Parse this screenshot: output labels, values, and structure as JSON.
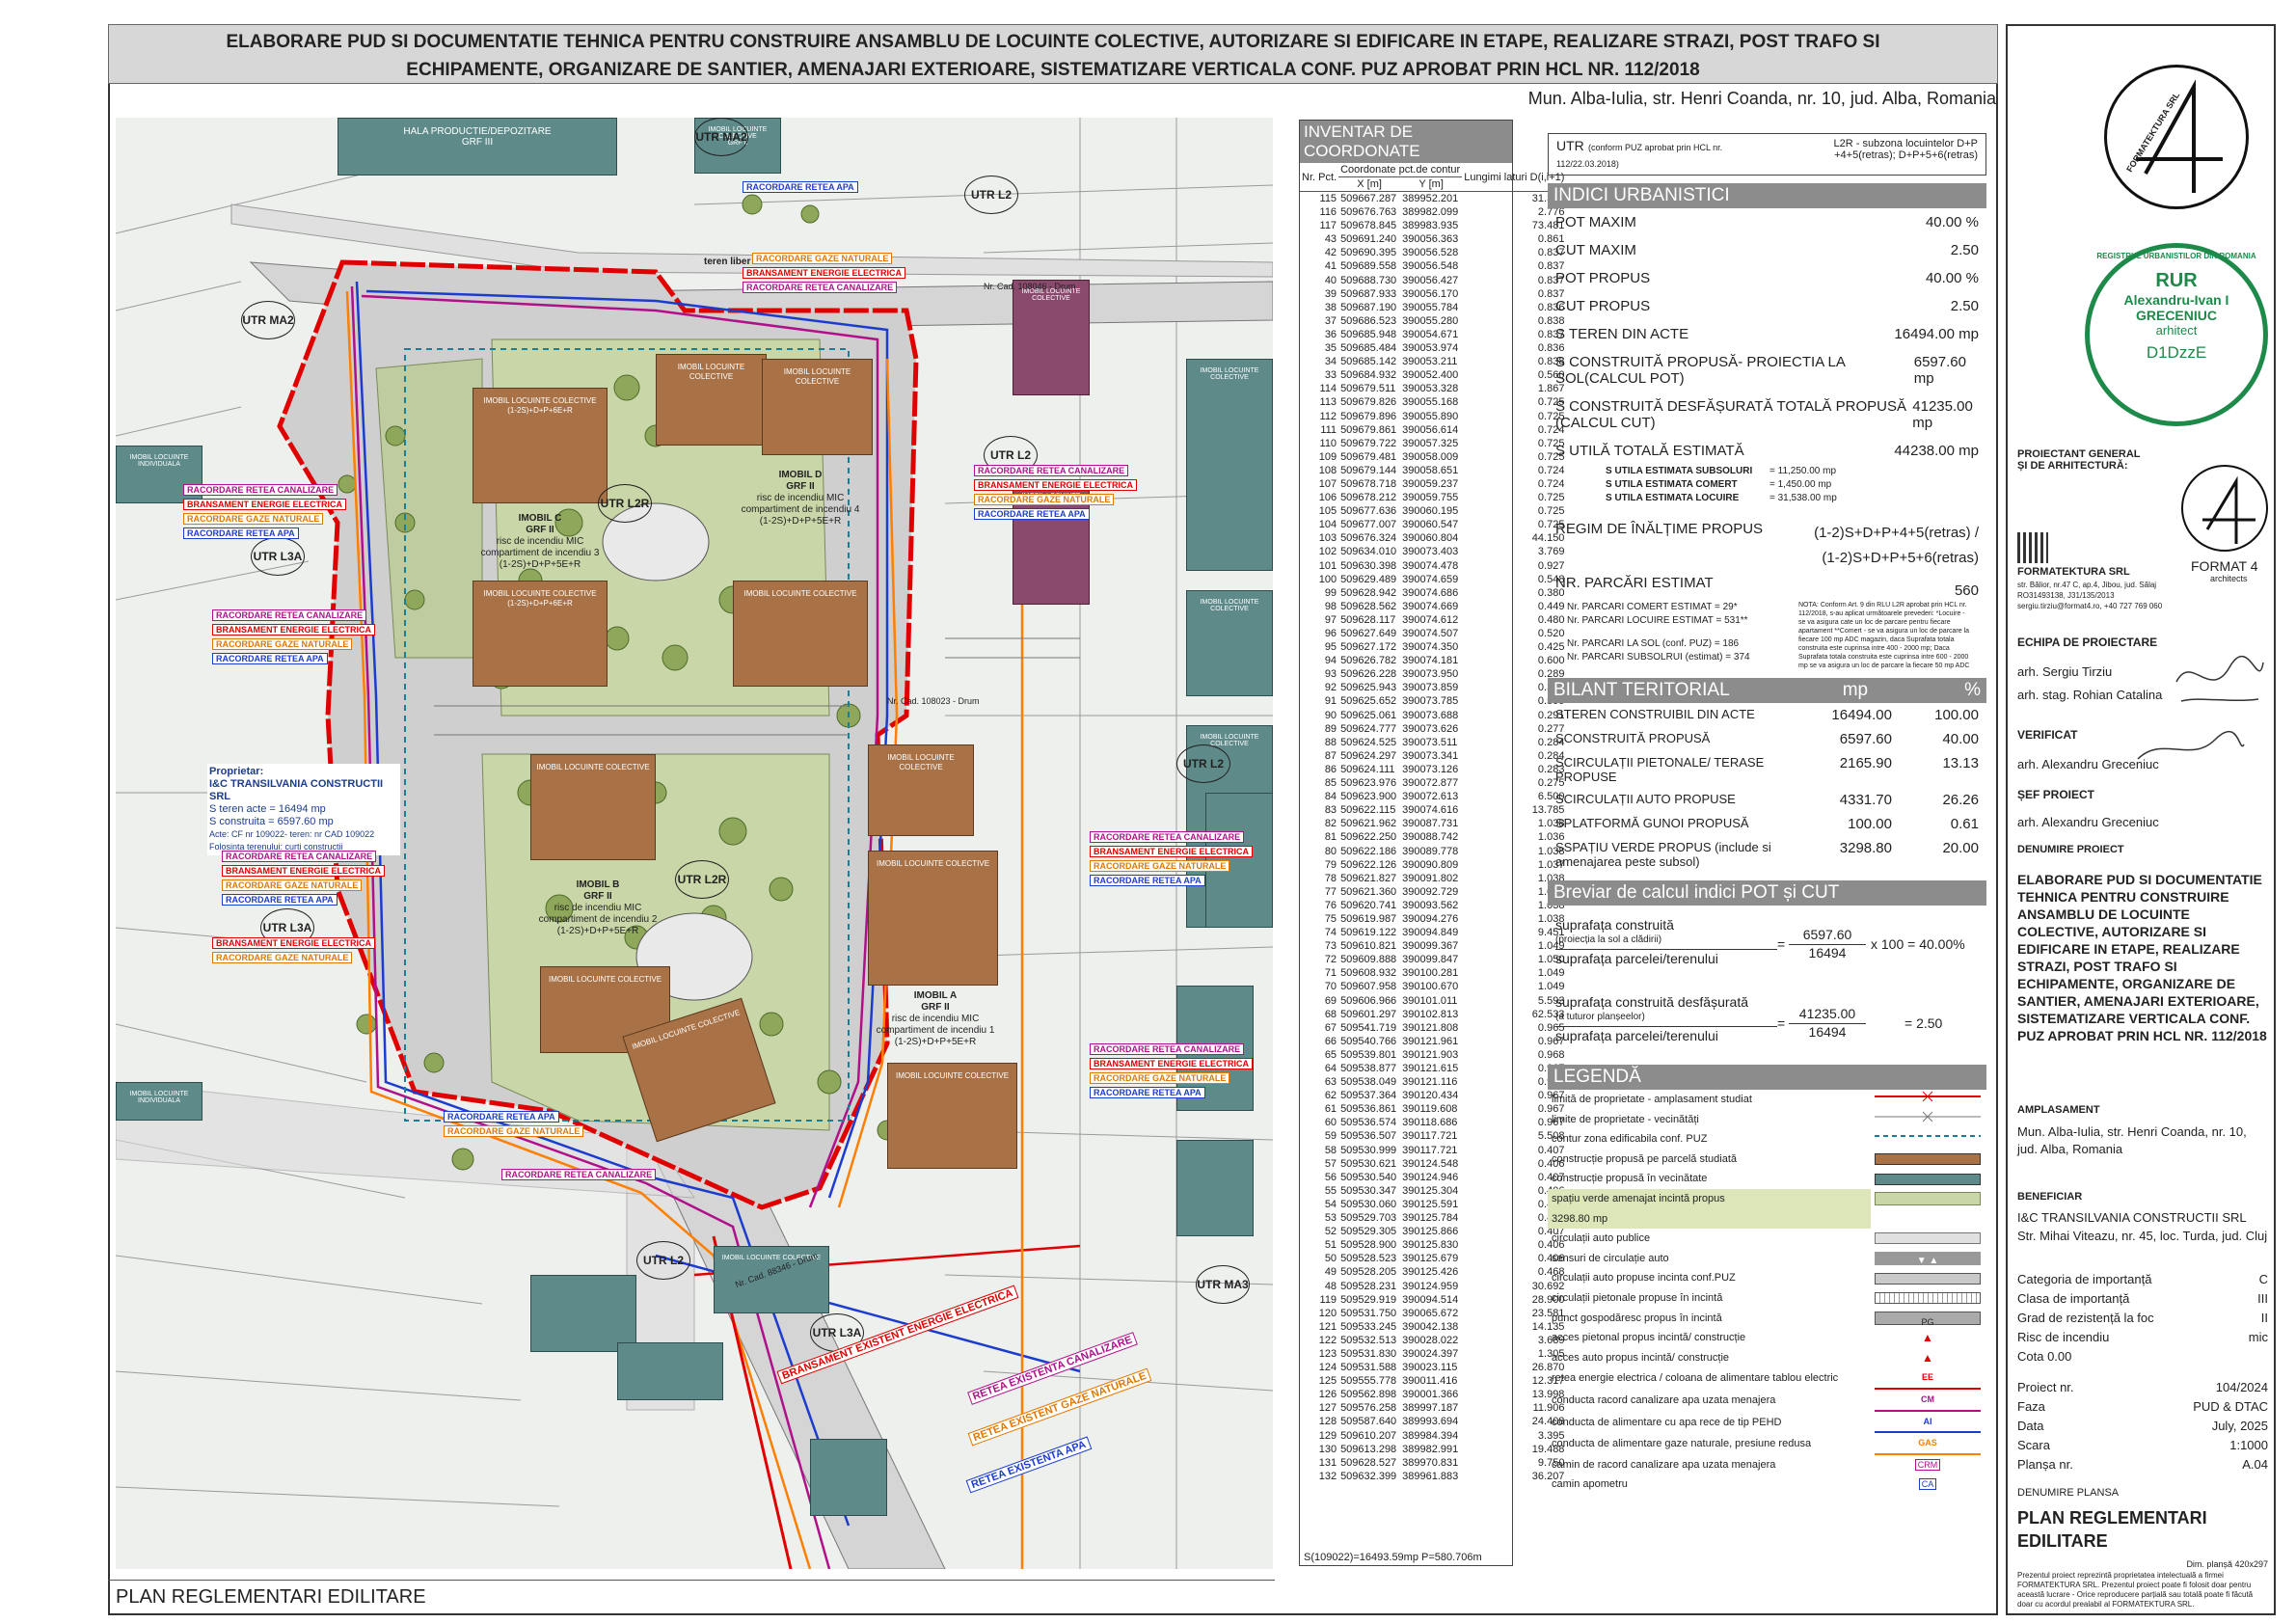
{
  "header": {
    "title_line1": "ELABORARE PUD SI DOCUMENTATIE TEHNICA PENTRU CONSTRUIRE ANSAMBLU DE LOCUINTE COLECTIVE, AUTORIZARE SI EDIFICARE IN ETAPE, REALIZARE STRAZI, POST TRAFO SI",
    "title_line2": "ECHIPAMENTE, ORGANIZARE DE SANTIER, AMENAJARI EXTERIOARE, SISTEMATIZARE VERTICALA CONF. PUZ APROBAT PRIN HCL NR. 112/2018",
    "location": "Mun. Alba-Iulia, str. Henri Coanda, nr. 10, jud. Alba, Romania"
  },
  "plan_title": "PLAN REGLEMENTARI EDILITARE",
  "map": {
    "zones": [
      "UTR MA2",
      "UTR L2",
      "UTR MA2",
      "UTR L2R",
      "UTR L3A",
      "UTR L2",
      "UTR L2R",
      "UTR L2",
      "UTR L3A",
      "UTR L2",
      "UTR L3A",
      "UTR MA3"
    ],
    "buildings": [
      {
        "name": "IMOBIL C",
        "sub": "GRF II",
        "text": "risc de incendiu MIC",
        "ci": "compartiment de incendiu 3",
        "lev": "(1-2S)+D+P+5E+R"
      },
      {
        "name": "IMOBIL D",
        "sub": "GRF II",
        "text": "risc de incendiu MIC",
        "ci": "compartiment de incendiu 4",
        "lev": "(1-2S)+D+P+5E+R"
      },
      {
        "name": "IMOBIL B",
        "sub": "GRF II",
        "text": "risc de incendiu MIC",
        "ci": "compartiment de incendiu 2",
        "lev": "(1-2S)+D+P+5E+R"
      },
      {
        "name": "IMOBIL A",
        "sub": "GRF II",
        "text": "risc de incendiu MIC",
        "ci": "compartiment de incendiu 1",
        "lev": "(1-2S)+D+P+5E+R"
      }
    ],
    "block_label": "IMOBIL LOCUINTE COLECTIVE",
    "block_levels": "(1-2S)+D+P+6E+R",
    "neighbors": [
      "HALA PRODUCTIE/DEPOZITARE",
      "GRF III",
      "IMOBIL LOCUINTE COLECTIVE",
      "GRF II",
      "IMOBIL LOCUINTE INDIVIDUALA",
      "GRF III"
    ],
    "callouts": [
      "RACORDARE RETEA APA",
      "RACORDARE GAZE NATURALE",
      "BRANSAMENT ENERGIE ELECTRICA",
      "RACORDARE RETEA CANALIZARE",
      "BRANSAMENT EXISTENT ENERGIE ELECTRICA",
      "RETEA EXISTENTA CANALIZARE",
      "RETEA EXISTENT GAZE NATURALE",
      "RETEA EXISTENTA APA"
    ],
    "owner": {
      "title": "Proprietar:",
      "name": "I&C TRANSILVANIA CONSTRUCTII SRL",
      "teren": "S teren acte = 16494 mp",
      "constr": "S construita = 6597.60 mp",
      "cf": "Acte: CF nr 109022- teren: nr CAD 109022",
      "fol": "Folosinta terenului: curti constructii"
    },
    "roads": [
      "Nr. Cad. 108046 - Drum",
      "teren liber de construiti",
      "Nr. Cad. 108023 - Drum",
      "Nr. Cad. 88346 - Drum"
    ]
  },
  "coords": {
    "title": "INVENTAR DE COORDONATE",
    "headers": [
      "Nr. Pct.",
      "Coordonate pct.de contur",
      "X [m]",
      "Y [m]",
      "Lungimi laturi D(i,i+1)"
    ],
    "rows": [
      [
        "115",
        "509667.287",
        "389952.201",
        "31.364"
      ],
      [
        "116",
        "509676.763",
        "389982.099",
        "2.776"
      ],
      [
        "117",
        "509678.845",
        "389983.935",
        "73.481"
      ],
      [
        "43",
        "509691.240",
        "390056.363",
        "0.861"
      ],
      [
        "42",
        "509690.395",
        "390056.528",
        "0.837"
      ],
      [
        "41",
        "509689.558",
        "390056.548",
        "0.837"
      ],
      [
        "40",
        "509688.730",
        "390056.427",
        "0.837"
      ],
      [
        "39",
        "509687.933",
        "390056.170",
        "0.837"
      ],
      [
        "38",
        "509687.190",
        "390055.784",
        "0.836"
      ],
      [
        "37",
        "509686.523",
        "390055.280",
        "0.838"
      ],
      [
        "36",
        "509685.948",
        "390054.671",
        "0.837"
      ],
      [
        "35",
        "509685.484",
        "390053.974",
        "0.836"
      ],
      [
        "34",
        "509685.142",
        "390053.211",
        "0.838"
      ],
      [
        "33",
        "509684.932",
        "390052.400",
        "0.560"
      ],
      [
        "114",
        "509679.511",
        "390053.328",
        "1.867"
      ],
      [
        "113",
        "509679.826",
        "390055.168",
        "0.725"
      ],
      [
        "112",
        "509679.896",
        "390055.890",
        "0.725"
      ],
      [
        "111",
        "509679.861",
        "390056.614",
        "0.724"
      ],
      [
        "110",
        "509679.722",
        "390057.325",
        "0.725"
      ],
      [
        "109",
        "509679.481",
        "390058.009",
        "0.725"
      ],
      [
        "108",
        "509679.144",
        "390058.651",
        "0.724"
      ],
      [
        "107",
        "509678.718",
        "390059.237",
        "0.724"
      ],
      [
        "106",
        "509678.212",
        "390059.755",
        "0.725"
      ],
      [
        "105",
        "509677.636",
        "390060.195",
        "0.725"
      ],
      [
        "104",
        "509677.007",
        "390060.547",
        "0.725"
      ],
      [
        "103",
        "509676.324",
        "390060.804",
        "44.150"
      ],
      [
        "102",
        "509634.010",
        "390073.403",
        "3.769"
      ],
      [
        "101",
        "509630.398",
        "390074.478",
        "0.927"
      ],
      [
        "100",
        "509629.489",
        "390074.659",
        "0.548"
      ],
      [
        "99",
        "509628.942",
        "390074.686",
        "0.380"
      ],
      [
        "98",
        "509628.562",
        "390074.669",
        "0.449"
      ],
      [
        "97",
        "509628.117",
        "390074.612",
        "0.480"
      ],
      [
        "96",
        "509627.649",
        "390074.507",
        "0.520"
      ],
      [
        "95",
        "509627.172",
        "390074.350",
        "0.425"
      ],
      [
        "94",
        "509626.782",
        "390074.181",
        "0.600"
      ],
      [
        "93",
        "509626.228",
        "390073.950",
        "0.289"
      ],
      [
        "92",
        "509625.943",
        "390073.859",
        "0.300"
      ],
      [
        "91",
        "509625.652",
        "390073.785",
        "0.599"
      ],
      [
        "90",
        "509625.061",
        "390073.688",
        "0.291"
      ],
      [
        "89",
        "509624.777",
        "390073.626",
        "0.277"
      ],
      [
        "88",
        "509624.525",
        "390073.511",
        "0.284"
      ],
      [
        "87",
        "509624.297",
        "390073.341",
        "0.284"
      ],
      [
        "86",
        "509624.111",
        "390073.126",
        "0.283"
      ],
      [
        "85",
        "509623.976",
        "390072.877",
        "0.275"
      ],
      [
        "84",
        "509623.900",
        "390072.613",
        "6.500"
      ],
      [
        "83",
        "509622.115",
        "390074.616",
        "13.785"
      ],
      [
        "82",
        "509621.962",
        "390087.731",
        "1.038"
      ],
      [
        "81",
        "509622.250",
        "390088.742",
        "1.036"
      ],
      [
        "80",
        "509622.186",
        "390089.778",
        "1.038"
      ],
      [
        "79",
        "509622.126",
        "390090.809",
        "1.037"
      ],
      [
        "78",
        "509621.827",
        "390091.802",
        "1.038"
      ],
      [
        "77",
        "509621.360",
        "390092.729",
        "1.038"
      ],
      [
        "76",
        "509620.741",
        "390093.562",
        "1.038"
      ],
      [
        "75",
        "509619.987",
        "390094.276",
        "1.038"
      ],
      [
        "74",
        "509619.122",
        "390094.849",
        "9.451"
      ],
      [
        "73",
        "509610.821",
        "390099.367",
        "1.049"
      ],
      [
        "72",
        "509609.888",
        "390099.847",
        "1.050"
      ],
      [
        "71",
        "509608.932",
        "390100.281",
        "1.049"
      ],
      [
        "70",
        "509607.958",
        "390100.670",
        "1.049"
      ],
      [
        "69",
        "509606.966",
        "390101.011",
        "5.593"
      ],
      [
        "68",
        "509601.297",
        "390102.813",
        "62.533"
      ],
      [
        "67",
        "509541.719",
        "390121.808",
        "0.965"
      ],
      [
        "66",
        "509540.766",
        "390121.961",
        "0.967"
      ],
      [
        "65",
        "509539.801",
        "390121.903",
        "0.968"
      ],
      [
        "64",
        "509538.877",
        "390121.615",
        "0.967"
      ],
      [
        "63",
        "509538.049",
        "390121.116",
        "0.967"
      ],
      [
        "62",
        "509537.364",
        "390120.434",
        "0.967"
      ],
      [
        "61",
        "509536.861",
        "390119.608",
        "0.967"
      ],
      [
        "60",
        "509536.574",
        "390118.686",
        "0.967"
      ],
      [
        "59",
        "509536.507",
        "390117.721",
        "5.508"
      ],
      [
        "58",
        "509530.999",
        "390117.721",
        "0.407"
      ],
      [
        "57",
        "509530.621",
        "390124.548",
        "0.406"
      ],
      [
        "56",
        "509530.540",
        "390124.946",
        "0.407"
      ],
      [
        "55",
        "509530.347",
        "390125.304",
        "0.406"
      ],
      [
        "54",
        "509530.060",
        "390125.591",
        "0.406"
      ],
      [
        "53",
        "509529.703",
        "390125.784",
        "0.406"
      ],
      [
        "52",
        "509529.305",
        "390125.866",
        "0.407"
      ],
      [
        "51",
        "509528.900",
        "390125.830",
        "0.406"
      ],
      [
        "50",
        "509528.523",
        "390125.679",
        "0.406"
      ],
      [
        "49",
        "509528.205",
        "390125.426",
        "0.468"
      ],
      [
        "48",
        "509528.231",
        "390124.959",
        "30.692"
      ],
      [
        "119",
        "509529.919",
        "390094.514",
        "28.900"
      ],
      [
        "120",
        "509531.750",
        "390065.672",
        "23.581"
      ],
      [
        "121",
        "509533.245",
        "390042.138",
        "14.135"
      ],
      [
        "122",
        "509532.513",
        "390028.022",
        "3.689"
      ],
      [
        "123",
        "509531.830",
        "390024.397",
        "1.305"
      ],
      [
        "124",
        "509531.588",
        "390023.115",
        "26.870"
      ],
      [
        "125",
        "509555.778",
        "390011.416",
        "12.317"
      ],
      [
        "126",
        "509562.898",
        "390001.366",
        "13.998"
      ],
      [
        "127",
        "509576.258",
        "389997.187",
        "11.906"
      ],
      [
        "128",
        "509587.640",
        "389993.694",
        "24.408"
      ],
      [
        "129",
        "509610.207",
        "389984.394",
        "3.395"
      ],
      [
        "130",
        "509613.298",
        "389982.991",
        "19.488"
      ],
      [
        "131",
        "509628.527",
        "389970.831",
        "9.750"
      ],
      [
        "132",
        "509632.399",
        "389961.883",
        "36.207"
      ]
    ],
    "footer": "S(109022)=16493.59mp  P=580.706m"
  },
  "utr": {
    "label": "UTR",
    "note": "(conform PUZ aprobat prin HCL nr. 112/22.03.2018)",
    "value": "L2R - subzona locuintelor D+P +4+5(retras); D+P+5+6(retras)"
  },
  "indici": {
    "title": "INDICI URBANISTICI",
    "rows": [
      [
        "POT MAXIM",
        "40.00 %"
      ],
      [
        "CUT MAXIM",
        "2.50"
      ],
      [
        "POT PROPUS",
        "40.00 %"
      ],
      [
        "CUT PROPUS",
        "2.50"
      ],
      [
        "S TEREN DIN ACTE",
        "16494.00 mp"
      ],
      [
        "S CONSTRUITĂ PROPUSĂ- PROIECTIA LA SOL(CALCUL POT)",
        "6597.60 mp"
      ],
      [
        "S CONSTRUITĂ DESFĂȘURATĂ TOTALĂ PROPUSĂ  (CALCUL CUT)",
        "41235.00 mp"
      ],
      [
        "S UTILĂ  TOTALĂ ESTIMATĂ",
        "44238.00 mp"
      ]
    ],
    "subrows": [
      [
        "S UTILA ESTIMATA SUBSOLURI",
        "= 11,250.00 mp"
      ],
      [
        "S UTILA ESTIMATA COMERT",
        "= 1,450.00 mp"
      ],
      [
        "S UTILA ESTIMATA LOCUIRE",
        "= 31,538.00 mp"
      ]
    ],
    "regim_label": "REGIM DE ÎNĂLȚIME PROPUS",
    "regim_value1": "(1-2)S+D+P+4+5(retras) /",
    "regim_value2": "(1-2)S+D+P+5+6(retras)",
    "parcari_label": "NR. PARCĂRI ESTIMAT",
    "parcari_value": "560",
    "parcari_rows": [
      "Nr. PARCARI COMERT ESTIMAT  =  29*",
      "Nr. PARCARI LOCUIRE ESTIMAT  =  531**",
      "Nr. PARCARI LA SOL (conf. PUZ)  =  186",
      "Nr. PARCARI SUBSOLRUI (estimat) = 374"
    ],
    "nota": "NOTA: Conform Art. 9 din RLU L2R aprobat prin HCL nr. 112/2018, s-au aplicat următoarele prevederi: *Locuire - se va asigura cate un loc de parcare pentru fiecare apartament **Comert - se va asigura un loc de parcare la fiecare 100 mp ADC magazin, daca Suprafata totala construita este cuprinsa intre 400 - 2000 mp; Daca Suprafata totala construita este cuprinsa intre 600 - 2000 mp se va asigura un loc de parcare la fiecare 50 mp ADC"
  },
  "bilant": {
    "title": "BILANT TERITORIAL",
    "col1": "mp",
    "col2": "%",
    "rows": [
      [
        "STEREN CONSTRUIBIL DIN ACTE",
        "16494.00",
        "100.00"
      ],
      [
        "SCONSTRUITĂ PROPUSĂ",
        "6597.60",
        "40.00"
      ],
      [
        "SCIRCULAȚII PIETONALE/ TERASE PROPUSE",
        "2165.90",
        "13.13"
      ],
      [
        "SCIRCULAȚII AUTO  PROPUSE",
        "4331.70",
        "26.26"
      ],
      [
        "SPLATFORMĂ GUNOI  PROPUSĂ",
        "100.00",
        "0.61"
      ],
      [
        "SSPAȚIU VERDE PROPUS (include si amenajarea peste subsol)",
        "3298.80",
        "20.00"
      ]
    ]
  },
  "breviar": {
    "title": "Breviar de calcul indici POT și CUT",
    "pot_num_label": "suprafața construită",
    "pot_num_sub": "(proiecția la sol a clădirii)",
    "pot_den_label": "suprafața parcelei/terenului",
    "pot_num": "6597.60",
    "pot_den": "16494",
    "pot_result": "x 100 = 40.00%",
    "cut_num_label": "suprafața construită desfășurată",
    "cut_num_sub": "(a tuturor planșeelor)",
    "cut_den_label": "suprafața parcelei/terenului",
    "cut_num": "41235.00",
    "cut_den": "16494",
    "cut_result": "= 2.50",
    "eq": "="
  },
  "legend": {
    "title": "LEGENDĂ",
    "items": [
      {
        "label": "limită de proprietate - amplasament studiat",
        "sym": "line-red-x"
      },
      {
        "label": "limite de proprietate - vecinătăți",
        "sym": "line-gray-x"
      },
      {
        "label": "contur zona edificabila conf. PUZ",
        "sym": "dash-teal"
      },
      {
        "label": "construcție propusă pe parcelă studiată",
        "sym": "box-brown"
      },
      {
        "label": "construcție propusă în vecinătate",
        "sym": "box-teal"
      },
      {
        "label": "spațiu verde amenajat incintă propus",
        "sym": "box-green"
      },
      {
        "label": "3298.80 mp",
        "sym": "none"
      },
      {
        "label": "circulații auto publice",
        "sym": "box-lgray"
      },
      {
        "label": "sensuri de circulație auto",
        "sym": "arrows"
      },
      {
        "label": "circulații auto propuse incinta conf.PUZ",
        "sym": "box-gray"
      },
      {
        "label": "circulații pietonale propuse în incintă",
        "sym": "box-stripe"
      },
      {
        "label": "punct gospodăresc propus în incintă",
        "sym": "pg"
      },
      {
        "label": "acces pietonal propus incintă/ construcție",
        "sym": "arrow-red"
      },
      {
        "label": "acces auto propus incintă/ construcție",
        "sym": "arrow-red2"
      },
      {
        "label": "retea energie electrica / coloana de alimentare tablou electric",
        "sym": "EE"
      },
      {
        "label": "conducta racord canalizare apa uzata menajera",
        "sym": "CM"
      },
      {
        "label": "conducta de alimentare cu apa rece de tip PEHD",
        "sym": "AI"
      },
      {
        "label": "conducta de alimentare gaze naturale, presiune redusa",
        "sym": "GAS"
      },
      {
        "label": "camin de racord canalizare apa uzata menajera",
        "sym": "CRM"
      },
      {
        "label": "camin apometru",
        "sym": "CA"
      }
    ]
  },
  "titleblock": {
    "firm_logo": "FORMATEKTURA SRL",
    "stamp": {
      "top": "RUR",
      "name1": "Alexandru-Ivan I",
      "name2": "GRECENIUC",
      "role": "arhitect",
      "code": "D1DzzE",
      "ring": "REGISTRUL URBANISTILOR DIN ROMANIA"
    },
    "proiectant_label": "PROIECTANT GENERAL ȘI DE ARHITECTURĂ:",
    "firm": "FORMATEKTURA SRL",
    "firm_addr": "str. Bălior, nr.47 C, ap.4, Jibou, jud. Sălaj",
    "firm_reg": "RO31493138, J31/135/2013",
    "firm_contact": "sergiu.tirziu@format4.ro, +40 727 769 060",
    "format4": "FORMAT 4",
    "format4_sub": "architects",
    "echipa_label": "ECHIPA DE PROIECTARE",
    "echipa": [
      "arh. Sergiu Tirziu",
      "arh. stag. Rohian Catalina"
    ],
    "verificat_label": "VERIFICAT",
    "verificat": "arh. Alexandru Greceniuc",
    "sef_label": "ȘEF PROIECT",
    "sef": "arh. Alexandru Greceniuc",
    "denumire_label": "DENUMIRE PROIECT",
    "denumire": "ELABORARE PUD SI DOCUMENTATIE TEHNICA PENTRU CONSTRUIRE ANSAMBLU DE LOCUINTE COLECTIVE, AUTORIZARE SI EDIFICARE IN ETAPE, REALIZARE STRAZI, POST TRAFO SI ECHIPAMENTE, ORGANIZARE DE SANTIER, AMENAJARI EXTERIOARE, SISTEMATIZARE VERTICALA CONF. PUZ APROBAT PRIN HCL NR. 112/2018",
    "amplasament_label": "AMPLASAMENT",
    "amplasament": "Mun. Alba-Iulia, str. Henri Coanda, nr. 10, jud. Alba, Romania",
    "beneficiar_label": "BENEFICIAR",
    "beneficiar": "I&C TRANSILVANIA CONSTRUCTII SRL",
    "beneficiar_addr": "Str. Mihai Viteazu, nr. 45, loc. Turda, jud. Cluj",
    "info": [
      [
        "Categoria de importanță",
        "C"
      ],
      [
        "Clasa de importanță",
        "III"
      ],
      [
        "Grad de rezistență la foc",
        "II"
      ],
      [
        "Risc de incendiu",
        "mic"
      ]
    ],
    "cota": "Cota 0.00",
    "info2": [
      [
        "Proiect nr.",
        "104/2024"
      ],
      [
        "Faza",
        "PUD & DTAC"
      ],
      [
        "Data",
        "July, 2025"
      ],
      [
        "Scara",
        "1:1000"
      ],
      [
        "Planșa nr.",
        "A.04"
      ]
    ],
    "plansa_label": "DENUMIRE PLANSA",
    "plansa": "PLAN REGLEMENTARI EDILITARE",
    "dim": "Dim. planșă 420x297",
    "copyright": "Prezentul proiect reprezintă proprietatea intelectuală a firmei FORMATEKTURA SRL. Prezentul proiect poate fi folosit doar pentru această lucrare - Orice reproducere parțială sau totală poate fi făcută doar cu acordul prealabil al FORMATEKTURA SRL."
  }
}
